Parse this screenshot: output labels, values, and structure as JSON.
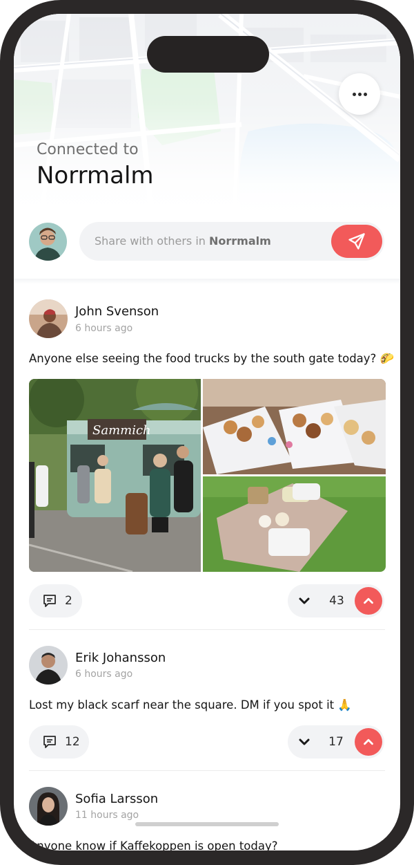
{
  "header": {
    "connected_label": "Connected to",
    "place": "Norrmalm",
    "more_icon": "ellipsis-icon"
  },
  "composer": {
    "placeholder_prefix": "Share with others in",
    "placeholder_place": "Norrmalm",
    "send_icon": "paper-plane-icon"
  },
  "colors": {
    "accent": "#f25a5a",
    "pill_bg": "#f2f3f5",
    "frame": "#2b2828"
  },
  "posts": [
    {
      "author": "John Svenson",
      "time": "6 hours ago",
      "text": "Anyone else seeing the food trucks by the south gate today?",
      "emoji": "🌮",
      "images": [
        "food-truck-photo",
        "pastries-photo",
        "picnic-blanket-photo"
      ],
      "truck_sign": "Sammich",
      "comments": "2",
      "votes": "43"
    },
    {
      "author": "Erik Johansson",
      "time": "6 hours ago",
      "text": "Lost my black scarf near the square. DM if you spot it",
      "emoji": "🙏",
      "comments": "12",
      "votes": "17"
    },
    {
      "author": "Sofia Larsson",
      "time": "11 hours ago",
      "text": "Anyone know if Kaffekoppen is open today?"
    }
  ]
}
